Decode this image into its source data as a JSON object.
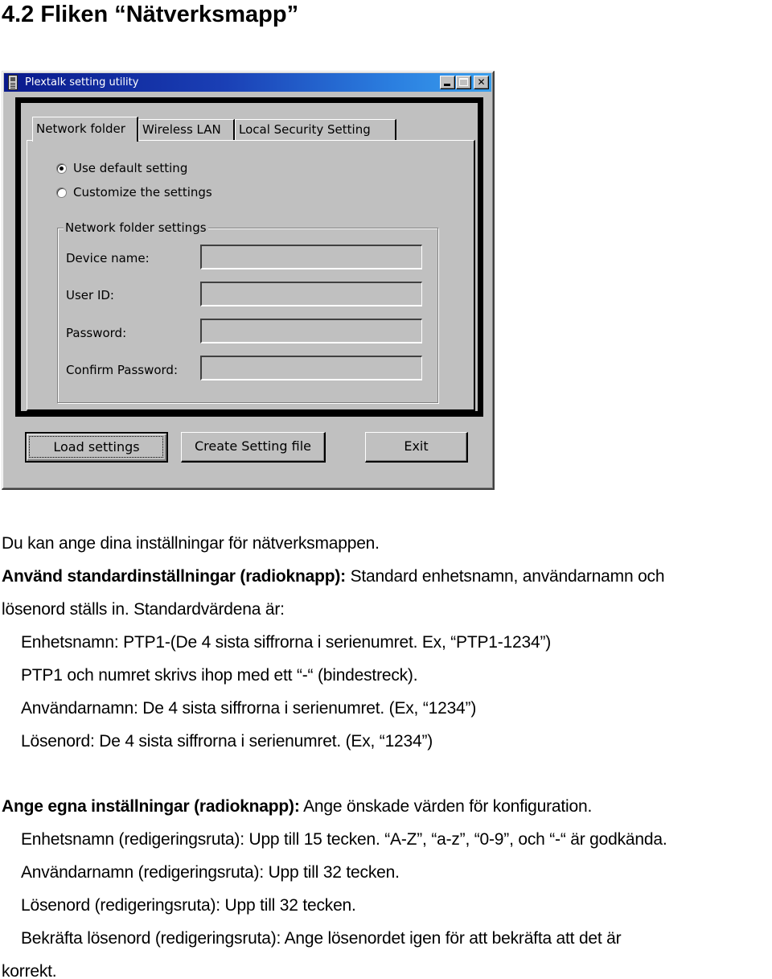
{
  "heading": "4.2 Fliken “Nätverksmapp”",
  "window": {
    "title": "Plextalk setting utility",
    "controls": {
      "minimize": "minimize",
      "maximize": "maximize",
      "close": "✕"
    },
    "tabs": [
      {
        "label": "Network folder",
        "active": true
      },
      {
        "label": "Wireless LAN",
        "active": false
      },
      {
        "label": "Local Security Setting",
        "active": false
      }
    ],
    "radios": [
      {
        "label": "Use default setting",
        "checked": true
      },
      {
        "label": "Customize the settings",
        "checked": false
      }
    ],
    "groupbox": {
      "label": "Network folder settings",
      "fields": [
        {
          "label": "Device name:",
          "value": ""
        },
        {
          "label": "User ID:",
          "value": ""
        },
        {
          "label": "Password:",
          "value": ""
        },
        {
          "label": "Confirm Password:",
          "value": ""
        }
      ]
    },
    "buttons": {
      "load": "Load settings",
      "create": "Create Setting file",
      "exit": "Exit"
    }
  },
  "body": {
    "intro": "Du kan ange dina inställningar för nätverksmappen.",
    "default_section": {
      "bold": "Använd standardinställningar (radioknapp):",
      "text_line1": " Standard enhetsnamn, användarnamn och",
      "text_line2": "lösenord ställs in. Standardvärdena är:",
      "items": [
        "Enhetsnamn:  PTP1-(De 4 sista siffrorna i serienumret. Ex, “PTP1-1234”)",
        "PTP1 och numret skrivs ihop med ett “-“ (bindestreck).",
        "Användarnamn: De 4 sista siffrorna i serienumret. (Ex, “1234”)",
        "Lösenord: De 4 sista siffrorna i serienumret. (Ex, “1234”)"
      ]
    },
    "custom_section": {
      "bold": "Ange egna inställningar (radioknapp):",
      "text": " Ange önskade värden för konfiguration.",
      "items": [
        "Enhetsnamn (redigeringsruta): Upp till 15 tecken. “A-Z”, “a-z”, “0-9”, och “-“ är godkända.",
        "Användarnamn (redigeringsruta): Upp till 32 tecken.",
        "Lösenord (redigeringsruta): Upp till 32 tecken.",
        "Bekräfta lösenord (redigeringsruta): Ange lösenordet igen för att bekräfta att det är"
      ],
      "last_line": "korrekt."
    }
  }
}
